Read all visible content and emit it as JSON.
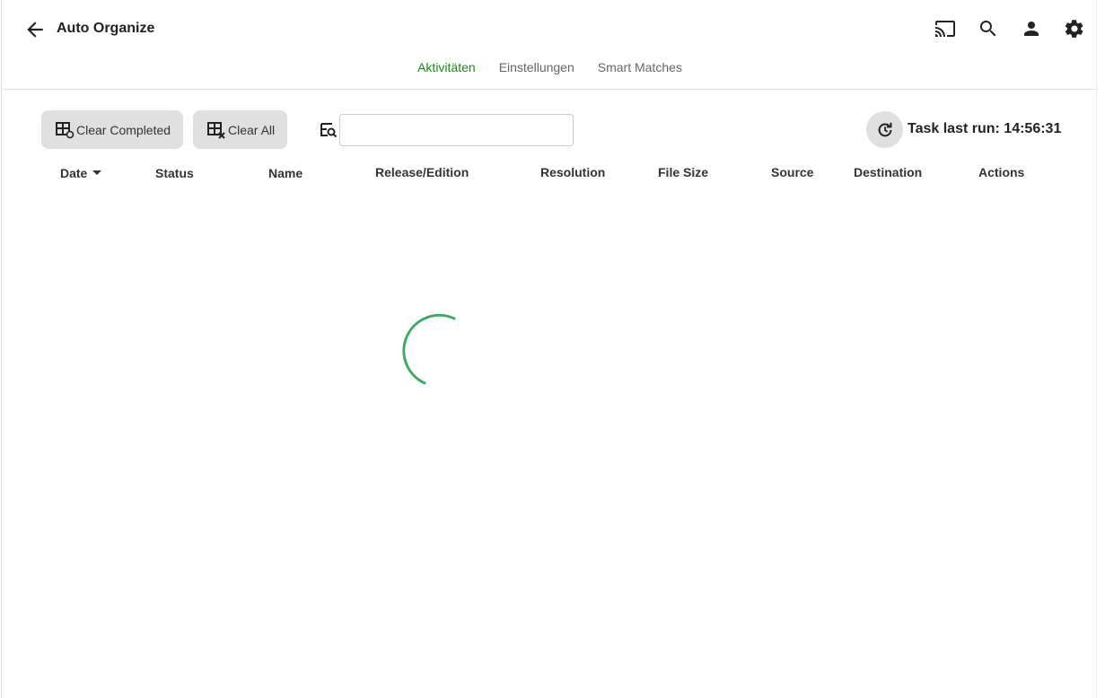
{
  "header": {
    "title": "Auto Organize"
  },
  "tabs": [
    {
      "label": "Aktivitäten",
      "active": true
    },
    {
      "label": "Einstellungen"
    },
    {
      "label": "Smart Matches"
    }
  ],
  "toolbar": {
    "clear_completed": "Clear Completed",
    "clear_all": "Clear All",
    "search_value": "",
    "last_run": "Task last run: 14:56:31"
  },
  "table": {
    "columns": [
      "Date",
      "Status",
      "Name",
      "Release/Edition",
      "Resolution",
      "File Size",
      "Source",
      "Destination",
      "Actions"
    ],
    "sort_column": "Date",
    "sort_direction": "desc"
  },
  "colors": {
    "accent": "#1a8a1a",
    "spinner": "#3daa63"
  }
}
